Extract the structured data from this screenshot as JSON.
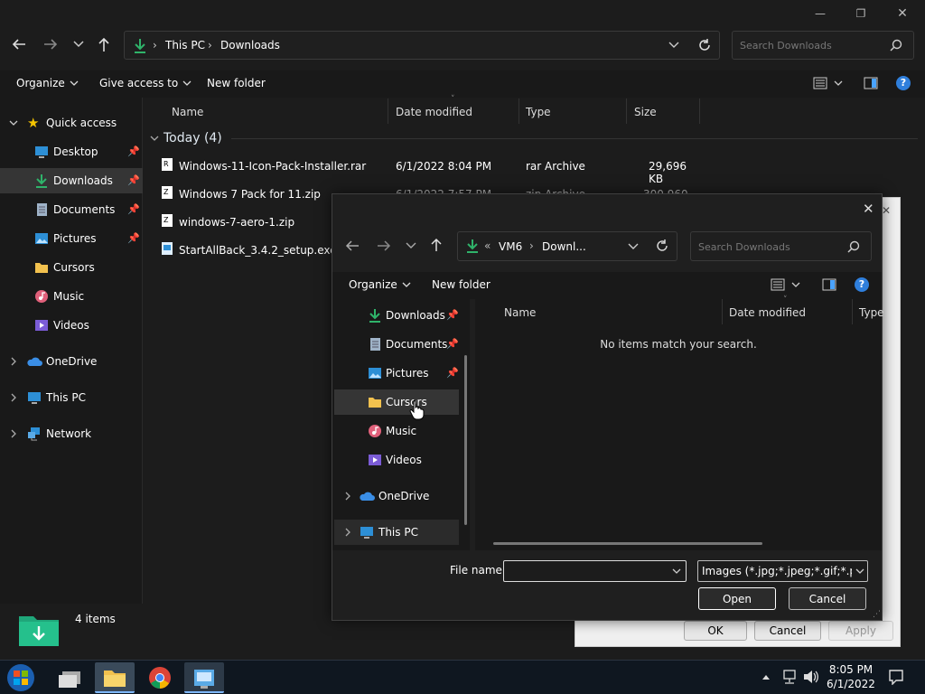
{
  "window": {
    "minimize": "—",
    "maximize": "❐",
    "close": "✕"
  },
  "address": {
    "segments": [
      "This PC",
      "Downloads"
    ]
  },
  "search": {
    "placeholder": "Search Downloads"
  },
  "toolbar": {
    "organize": "Organize",
    "give_access": "Give access to",
    "new_folder": "New folder"
  },
  "sidebar": {
    "quick_access": "Quick access",
    "items": [
      {
        "label": "Desktop",
        "pinned": true
      },
      {
        "label": "Downloads",
        "pinned": true
      },
      {
        "label": "Documents",
        "pinned": true
      },
      {
        "label": "Pictures",
        "pinned": true
      },
      {
        "label": "Cursors",
        "pinned": false
      },
      {
        "label": "Music",
        "pinned": false
      },
      {
        "label": "Videos",
        "pinned": false
      }
    ],
    "onedrive": "OneDrive",
    "this_pc": "This PC",
    "network": "Network"
  },
  "columns": {
    "name": "Name",
    "date": "Date modified",
    "type": "Type",
    "size": "Size"
  },
  "group": {
    "label": "Today (4)"
  },
  "files": [
    {
      "name": "Windows-11-Icon-Pack-Installer.rar",
      "date": "6/1/2022 8:04 PM",
      "type": "rar Archive",
      "size": "29,696 KB"
    },
    {
      "name": "Windows 7 Pack for 11.zip",
      "date": "6/1/2022 7:57 PM",
      "type": "zip Archive",
      "size": "300,960 KB"
    },
    {
      "name": "windows-7-aero-1.zip",
      "date": "",
      "type": "",
      "size": ""
    },
    {
      "name": "StartAllBack_3.4.2_setup.exe",
      "date": "",
      "type": "",
      "size": ""
    }
  ],
  "status": {
    "count": "4 items"
  },
  "behind_dialog": {
    "ok": "OK",
    "cancel": "Cancel",
    "apply": "Apply"
  },
  "dialog": {
    "close": "✕",
    "address": {
      "segments": [
        "VM6",
        "Downl..."
      ]
    },
    "search_placeholder": "Search Downloads",
    "toolbar": {
      "organize": "Organize",
      "new_folder": "New folder"
    },
    "nav": [
      {
        "label": "Downloads",
        "pinned": true
      },
      {
        "label": "Documents",
        "pinned": true
      },
      {
        "label": "Pictures",
        "pinned": true
      },
      {
        "label": "Cursors",
        "pinned": false
      },
      {
        "label": "Music",
        "pinned": false
      },
      {
        "label": "Videos",
        "pinned": false
      }
    ],
    "onedrive": "OneDrive",
    "this_pc": "This PC",
    "columns": {
      "name": "Name",
      "date": "Date modified",
      "type": "Type"
    },
    "empty": "No items match your search.",
    "filename_label": "File name:",
    "filename_value": "",
    "filter": "Images (*.jpg;*.jpeg;*.gif;*.png;",
    "open": "Open",
    "cancel": "Cancel"
  },
  "taskbar": {
    "time": "8:05 PM",
    "date": "6/1/2022"
  },
  "colors": {
    "accent": "#3a8ee6",
    "download_green": "#2fb36a",
    "folder_yellow": "#f2c14e",
    "star": "#f5c400"
  }
}
